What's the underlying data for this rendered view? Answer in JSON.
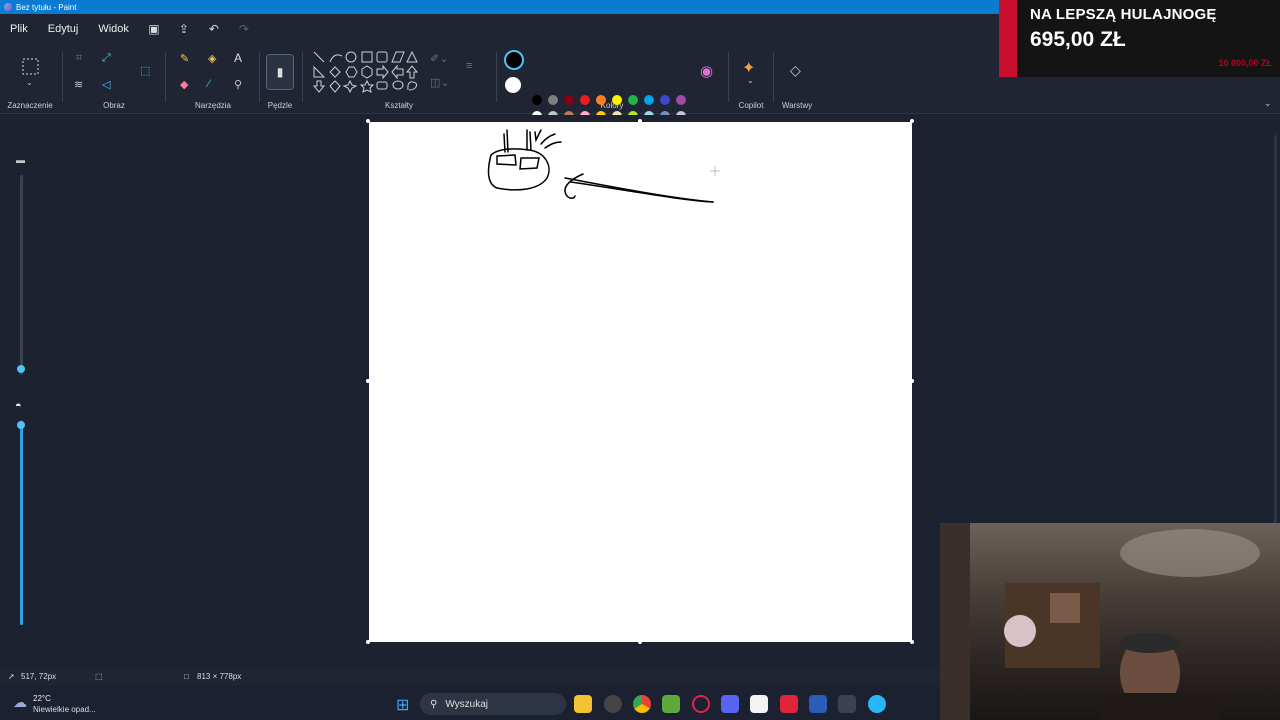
{
  "window": {
    "title": "Bez tytułu - Paint"
  },
  "menu": {
    "items": [
      "Plik",
      "Edytuj",
      "Widok"
    ]
  },
  "ribbon": {
    "groups": {
      "selection": "Zaznaczenie",
      "image": "Obraz",
      "tools": "Narzędzia",
      "brushes": "Pędzle",
      "shapes": "Kształty",
      "colors": "Kolory",
      "copilot": "Copilot",
      "layers": "Warstwy"
    },
    "palette_row1": [
      "#000000",
      "#7f7f7f",
      "#880015",
      "#ed1c24",
      "#ff7f27",
      "#fff200",
      "#22b14c",
      "#00a2e8",
      "#3f48cc",
      "#a349a4"
    ],
    "palette_row2": [
      "#ffffff",
      "#c3c3c3",
      "#b97a57",
      "#ffaec9",
      "#ffc90e",
      "#efe4b0",
      "#b5e61d",
      "#99d9ea",
      "#7092be",
      "#c8bfe7"
    ],
    "primary_color": "#000000",
    "secondary_color": "#ffffff"
  },
  "status": {
    "cursor_pos": "517, 72px",
    "canvas_size": "813 × 778px"
  },
  "weather": {
    "temp": "22°C",
    "desc": "Niewielkie opad..."
  },
  "taskbar": {
    "search_placeholder": "Wyszukaj"
  },
  "donation_overlay": {
    "title": "NA LEPSZĄ HULAJNOGĘ",
    "amount": "695,00 ZŁ",
    "goal": "10 000,00 ZŁ"
  }
}
